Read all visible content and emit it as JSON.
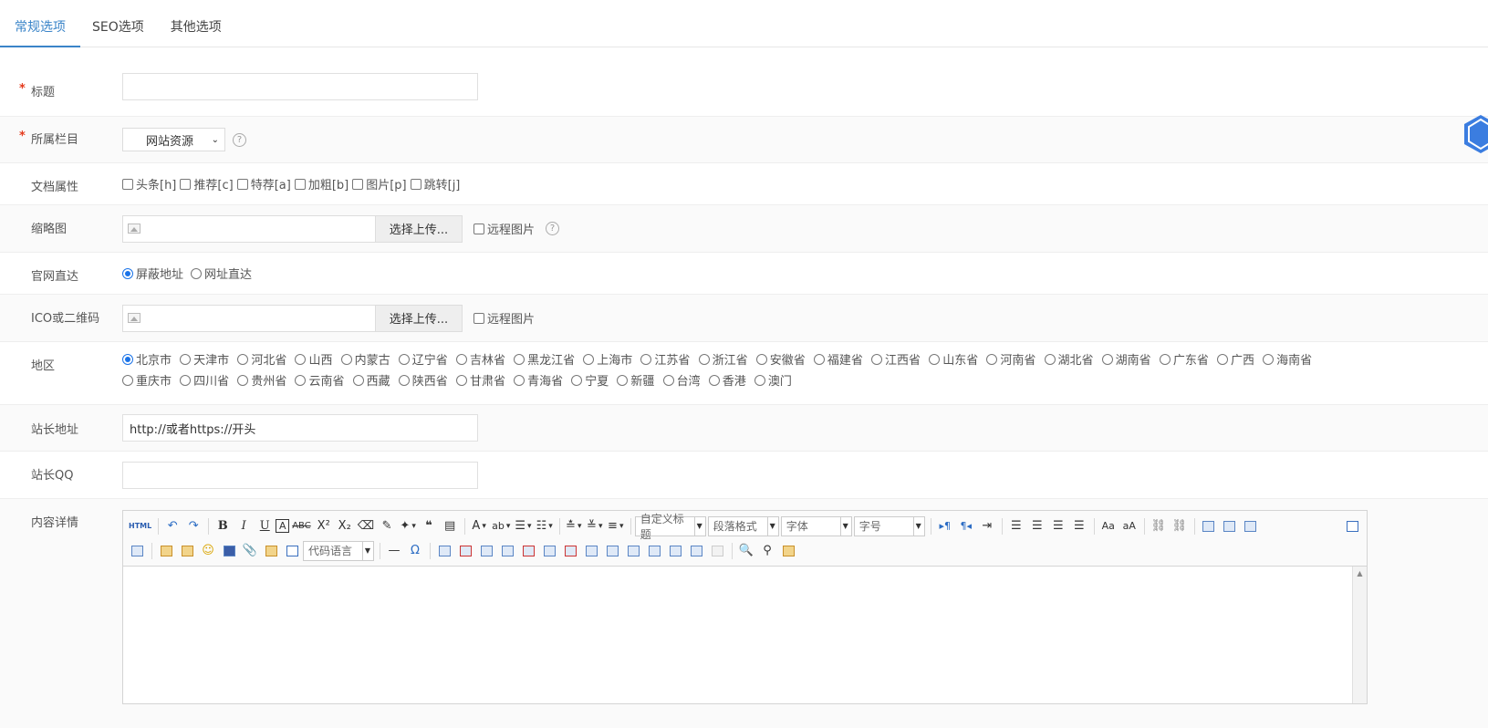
{
  "tabs": [
    {
      "label": "常规选项",
      "active": true
    },
    {
      "label": "SEO选项",
      "active": false
    },
    {
      "label": "其他选项",
      "active": false
    }
  ],
  "fields": {
    "title": {
      "label": "标题",
      "value": ""
    },
    "category": {
      "label": "所属栏目",
      "selected": "网站资源"
    },
    "attributes": {
      "label": "文档属性",
      "options": [
        "头条[h]",
        "推荐[c]",
        "特荐[a]",
        "加粗[b]",
        "图片[p]",
        "跳转[j]"
      ]
    },
    "thumbnail": {
      "label": "缩略图",
      "button": "选择上传...",
      "remote": "远程图片"
    },
    "official": {
      "label": "官网直达",
      "options": [
        "屏蔽地址",
        "网址直达"
      ],
      "selected": "屏蔽地址"
    },
    "ico": {
      "label": "ICO或二维码",
      "button": "选择上传...",
      "remote": "远程图片"
    },
    "region": {
      "label": "地区",
      "selected": "北京市",
      "options": [
        "北京市",
        "天津市",
        "河北省",
        "山西",
        "内蒙古",
        "辽宁省",
        "吉林省",
        "黑龙江省",
        "上海市",
        "江苏省",
        "浙江省",
        "安徽省",
        "福建省",
        "江西省",
        "山东省",
        "河南省",
        "湖北省",
        "湖南省",
        "广东省",
        "广西",
        "海南省",
        "重庆市",
        "四川省",
        "贵州省",
        "云南省",
        "西藏",
        "陕西省",
        "甘肃省",
        "青海省",
        "宁夏",
        "新疆",
        "台湾",
        "香港",
        "澳门"
      ]
    },
    "webmaster_url": {
      "label": "站长地址",
      "value": "http://或者https://开头"
    },
    "webmaster_qq": {
      "label": "站长QQ",
      "value": ""
    },
    "content": {
      "label": "内容详情",
      "combos": {
        "custom_title": "自定义标题",
        "paragraph": "段落格式",
        "font": "字体",
        "size": "字号",
        "code_lang": "代码语言"
      }
    }
  },
  "icons": {
    "help": "question-circle-icon",
    "image_placeholder": "image-icon",
    "side_float": "hexagon-icon"
  },
  "colors": {
    "accent": "#3a84c8",
    "required": "#e4391b",
    "radio_checked": "#1a73e8"
  }
}
